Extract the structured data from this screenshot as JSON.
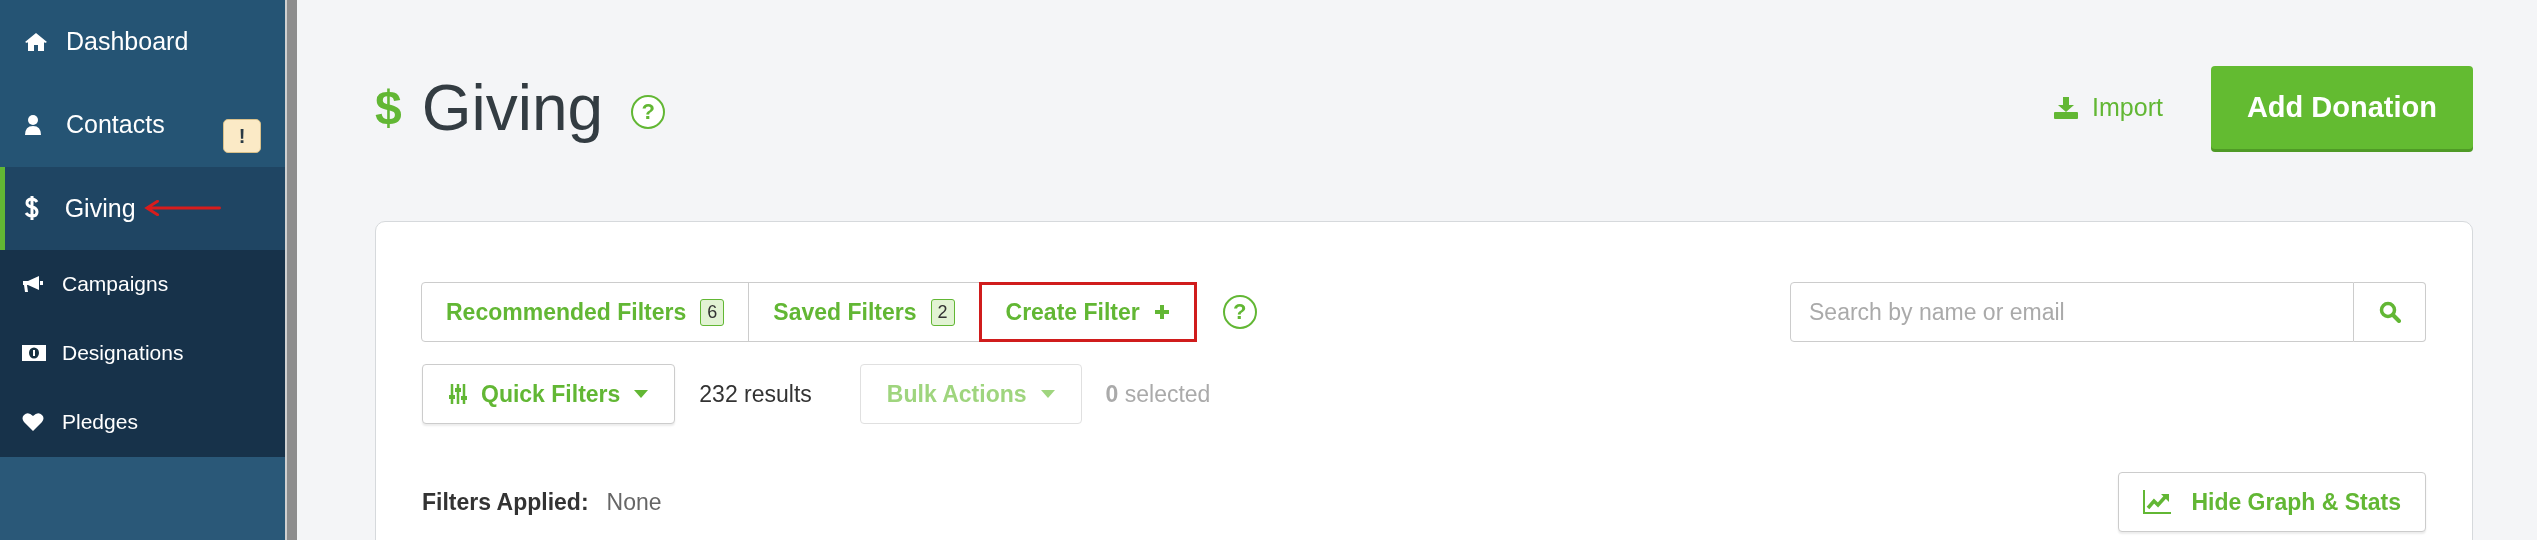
{
  "sidebar": {
    "items": [
      {
        "label": "Dashboard",
        "kind": "main",
        "selected": false
      },
      {
        "label": "Contacts",
        "kind": "main",
        "selected": false,
        "badge": "!"
      },
      {
        "label": "Giving",
        "kind": "main",
        "selected": true,
        "annotated": true
      },
      {
        "label": "Campaigns",
        "kind": "sub",
        "selected": false
      },
      {
        "label": "Designations",
        "kind": "sub",
        "selected": false
      },
      {
        "label": "Pledges",
        "kind": "sub",
        "selected": false
      }
    ]
  },
  "header": {
    "icon": "$",
    "title": "Giving",
    "help": "?",
    "import": "Import",
    "add_button": "Add Donation"
  },
  "filter_tabs": [
    {
      "label": "Recommended Filters",
      "kind": "filter",
      "count": "6",
      "highlighted": false
    },
    {
      "label": "Saved Filters",
      "kind": "filter",
      "count": "2",
      "highlighted": false
    },
    {
      "label": "Create Filter",
      "kind": "create",
      "highlighted": true
    }
  ],
  "filter_help": "?",
  "search": {
    "placeholder": "Search by name or email"
  },
  "quick_filters": {
    "label": "Quick Filters",
    "disabled": false
  },
  "results": {
    "count": "232",
    "label": "results"
  },
  "bulk_actions": {
    "label": "Bulk Actions",
    "disabled": true
  },
  "selection": {
    "count": "0",
    "label": "selected"
  },
  "filters_applied": {
    "label": "Filters Applied:",
    "value": "None"
  },
  "graph_button": "Hide Graph & Stats"
}
